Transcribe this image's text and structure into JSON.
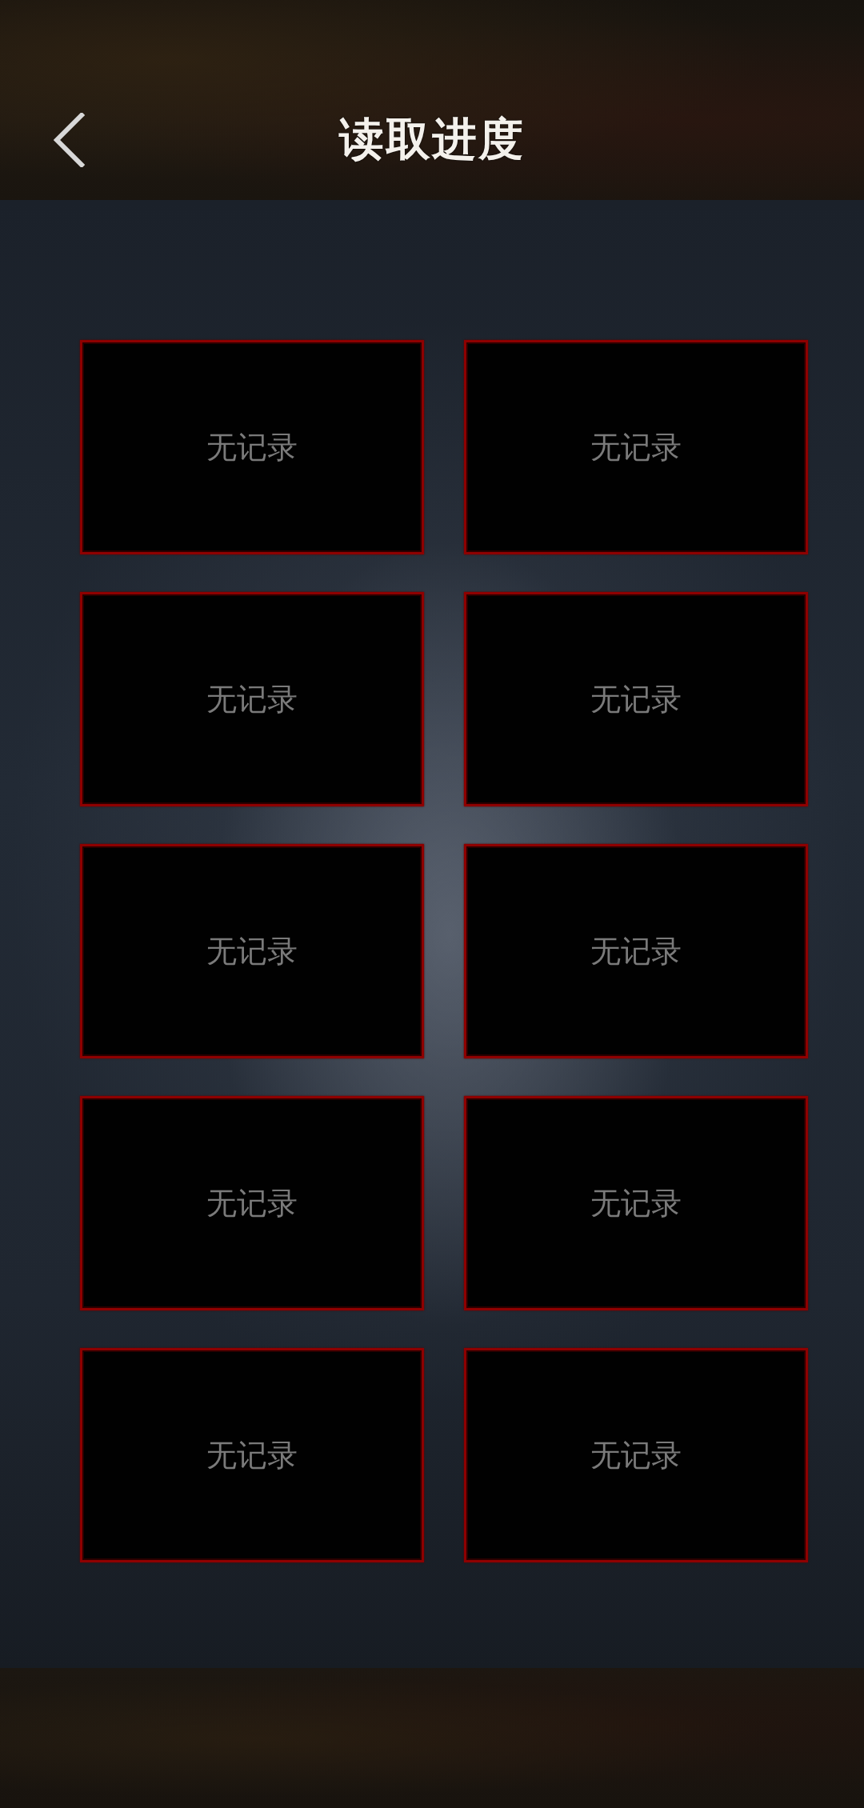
{
  "header": {
    "title": "读取进度"
  },
  "save_slots": [
    {
      "label": "无记录"
    },
    {
      "label": "无记录"
    },
    {
      "label": "无记录"
    },
    {
      "label": "无记录"
    },
    {
      "label": "无记录"
    },
    {
      "label": "无记录"
    },
    {
      "label": "无记录"
    },
    {
      "label": "无记录"
    },
    {
      "label": "无记录"
    },
    {
      "label": "无记录"
    }
  ]
}
